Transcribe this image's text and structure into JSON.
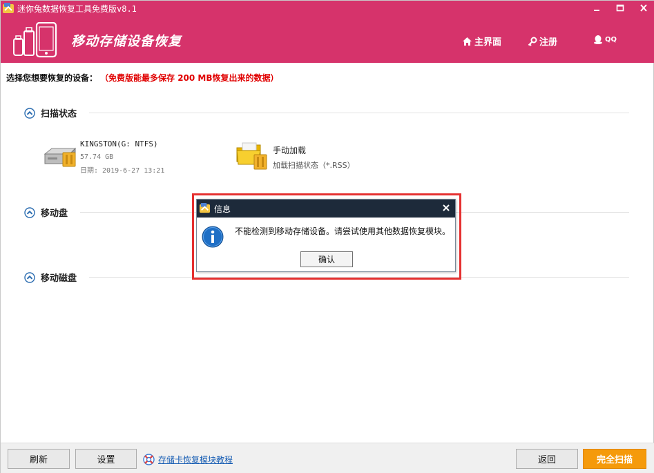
{
  "window": {
    "title": "迷你兔数据恢复工具免费版v8.1",
    "controls": [
      "minimize",
      "maximize",
      "close"
    ]
  },
  "header": {
    "brand": "移动存储设备恢复",
    "nav": [
      {
        "label": "主界面",
        "icon": "home-icon"
      },
      {
        "label": "注册",
        "icon": "key-icon"
      },
      {
        "label": "QQ",
        "icon": "qq-penguin-icon"
      }
    ]
  },
  "content": {
    "prompt": "选择您想要恢复的设备：",
    "free_notice": "（免费版能最多保存 200 MB恢复出来的数据）",
    "sections": {
      "scan_status": {
        "label": "扫描状态",
        "device": {
          "name": "KINGSTON(G: NTFS)",
          "size": "57.74 GB",
          "date": "日期: 2019-6-27 13:21"
        },
        "manual_load": {
          "title": "手动加载",
          "subtitle": "加载扫描状态（*.RSS）"
        }
      },
      "removable_disk": {
        "label": "移动盘"
      },
      "removable_hdd": {
        "label": "移动磁盘"
      }
    }
  },
  "dialog": {
    "title": "信息",
    "message": "不能检测到移动存储设备。请尝试使用其他数据恢复模块。",
    "ok_label": "确认"
  },
  "footer": {
    "refresh_label": "刷新",
    "settings_label": "设置",
    "tutorial_label": "存储卡恢复模块教程",
    "back_label": "返回",
    "full_scan_label": "完全扫描"
  },
  "colors": {
    "brand": "#d6336b",
    "accent_orange": "#f59a0b",
    "dialog_title_bg": "#1d2a3a",
    "highlight_red": "#e53030",
    "link_blue": "#1a5fb4",
    "info_blue": "#1f6fc5"
  }
}
